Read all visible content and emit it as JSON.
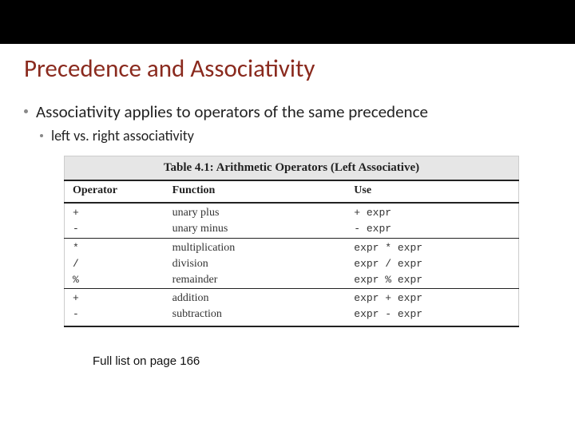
{
  "title": "Precedence and Associativity",
  "bullet1": "Associativity applies to operators of the same precedence",
  "bullet2": "left vs. right associativity",
  "table": {
    "caption": "Table 4.1: Arithmetic Operators (Left Associative)",
    "headers": {
      "op": "Operator",
      "fn": "Function",
      "use": "Use"
    },
    "rows": [
      {
        "op": "+",
        "fn": "unary plus",
        "use": "+ expr"
      },
      {
        "op": "-",
        "fn": "unary minus",
        "use": "- expr"
      },
      {
        "op": "*",
        "fn": "multiplication",
        "use": "expr * expr"
      },
      {
        "op": "/",
        "fn": "division",
        "use": "expr / expr"
      },
      {
        "op": "%",
        "fn": "remainder",
        "use": "expr % expr"
      },
      {
        "op": "+",
        "fn": "addition",
        "use": "expr + expr"
      },
      {
        "op": "-",
        "fn": "subtraction",
        "use": "expr - expr"
      }
    ]
  },
  "footnote": "Full list on page 166"
}
